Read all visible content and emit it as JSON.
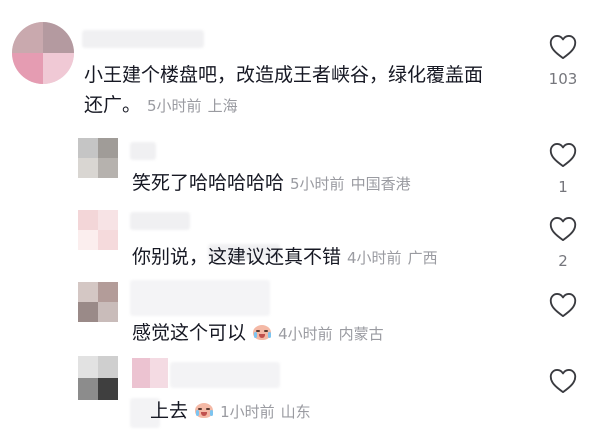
{
  "comments": [
    {
      "text_line1": "小王建个楼盘吧，改造成王者峡谷，绿化覆盖面",
      "text_line2": "还广。",
      "time": "5小时前",
      "location": "上海",
      "likes": "103"
    },
    {
      "text": "笑死了哈哈哈哈哈",
      "time": "5小时前",
      "location": "中国香港",
      "likes": "1"
    },
    {
      "text": "你别说，这建议还真不错",
      "time": "4小时前",
      "location": "广西",
      "likes": "2"
    },
    {
      "text": "感觉这个可以",
      "emoji": "crying-laughing-emoji",
      "time": "4小时前",
      "location": "内蒙古",
      "likes": ""
    },
    {
      "text": "上去",
      "emoji": "crying-laughing-emoji",
      "time": "1小时前",
      "location": "山东",
      "likes": ""
    }
  ],
  "icons": {
    "like": "heart-outline-icon"
  },
  "colors": {
    "meta": "#9a9ba1",
    "count": "#75767c",
    "text": "#161823"
  }
}
